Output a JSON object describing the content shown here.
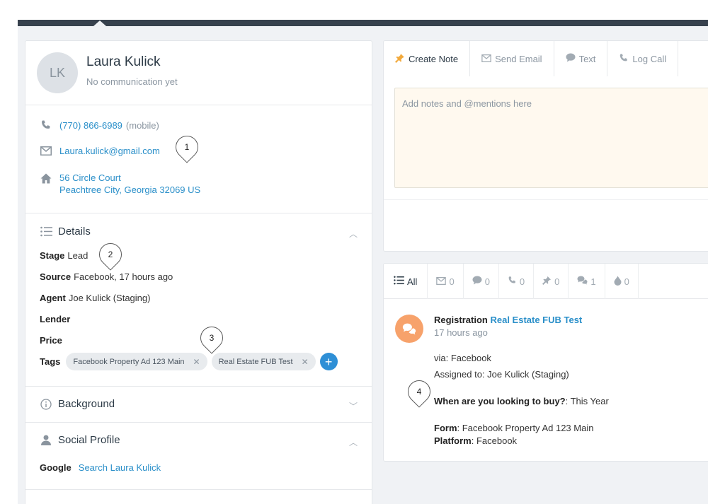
{
  "contact": {
    "initials": "LK",
    "name": "Laura Kulick",
    "status": "No communication yet",
    "phone": "(770) 866-6989",
    "phone_type": "(mobile)",
    "email": "Laura.kulick@gmail.com",
    "address_line1": "56 Circle Court",
    "address_line2": "Peachtree City, Georgia 32069 US"
  },
  "details": {
    "title": "Details",
    "stage_label": "Stage",
    "stage_value": "Lead",
    "source_label": "Source",
    "source_value": "Facebook, 17 hours ago",
    "agent_label": "Agent",
    "agent_value": "Joe Kulick (Staging)",
    "lender_label": "Lender",
    "price_label": "Price",
    "tags_label": "Tags",
    "tags": [
      "Facebook Property Ad 123 Main",
      "Real Estate FUB Test"
    ],
    "tag_remove": "✕",
    "add_tag": "+"
  },
  "background": {
    "title": "Background"
  },
  "social": {
    "title": "Social Profile",
    "google_label": "Google",
    "google_link": "Search Laura Kulick"
  },
  "callouts": [
    "1",
    "2",
    "3",
    "4"
  ],
  "composer": {
    "tabs": [
      "Create Note",
      "Send Email",
      "Text",
      "Log Call"
    ],
    "placeholder": "Add notes and @mentions here"
  },
  "feed": {
    "filters": [
      {
        "icon": "list-icon",
        "label": "All"
      },
      {
        "icon": "email-icon",
        "label": "0"
      },
      {
        "icon": "text-icon",
        "label": "0"
      },
      {
        "icon": "call-icon",
        "label": "0"
      },
      {
        "icon": "note-icon",
        "label": "0"
      },
      {
        "icon": "event-icon",
        "label": "1"
      },
      {
        "icon": "drip-icon",
        "label": "0"
      }
    ],
    "activity": {
      "type": "Registration",
      "source_link": "Real Estate FUB Test",
      "time": "17 hours ago",
      "via": "via: Facebook",
      "assigned": "Assigned to: Joe Kulick (Staging)",
      "question": "When are you looking to buy?",
      "answer": ": This Year",
      "form_label": "Form",
      "form_value": ": Facebook Property Ad 123 Main",
      "platform_label": "Platform",
      "platform_value": ": Facebook"
    }
  },
  "colors": {
    "link": "#2a8fc9",
    "accent": "#2e8fd6",
    "activity_badge": "#f7a26b",
    "topbar": "#37414d"
  }
}
